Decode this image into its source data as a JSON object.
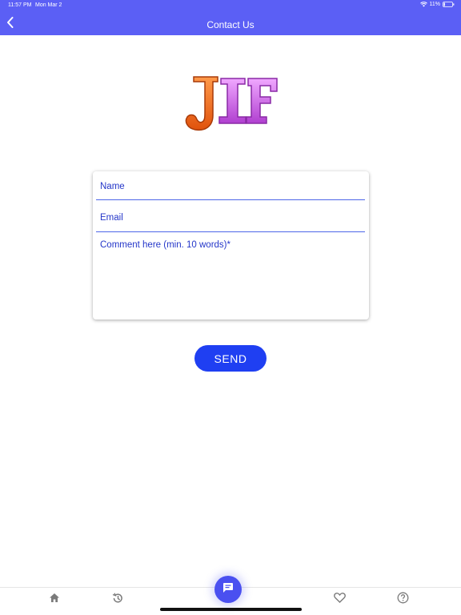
{
  "status_bar": {
    "time": "11:57 PM",
    "date": "Mon Mar 2",
    "battery": "11%"
  },
  "header": {
    "title": "Contact Us",
    "back_icon": "chevron-left-icon",
    "background": "#5b5ff5"
  },
  "logo": {
    "text": "JIF",
    "colors": [
      "#f26a1b",
      "#c84fd8"
    ]
  },
  "form": {
    "name_placeholder": "Name",
    "email_placeholder": "Email",
    "comment_placeholder": "Comment here (min. 10 words)*"
  },
  "send_button": {
    "label": "SEND",
    "color": "#1f3ff2"
  },
  "bottom_nav": {
    "items": [
      {
        "icon": "home-icon"
      },
      {
        "icon": "history-icon"
      },
      {
        "icon": "chat-icon"
      },
      {
        "icon": "heart-icon"
      },
      {
        "icon": "help-icon"
      }
    ]
  }
}
